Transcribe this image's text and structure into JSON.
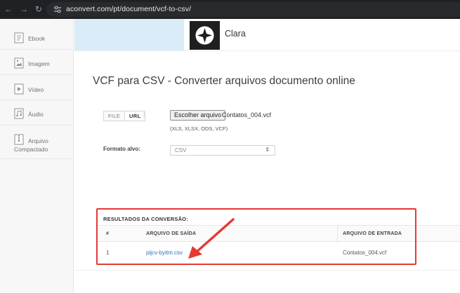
{
  "browser": {
    "url": "aconvert.com/pt/document/vcf-to-csv/"
  },
  "sidebar": {
    "items": [
      {
        "label": "Ebook",
        "icon": "ebook-icon"
      },
      {
        "label": "Imagem",
        "icon": "image-icon"
      },
      {
        "label": "Vídeo",
        "icon": "video-icon"
      },
      {
        "label": "Áudio",
        "icon": "audio-icon"
      },
      {
        "label": "Arquivo Compactado",
        "icon": "archive-icon"
      }
    ]
  },
  "ad": {
    "brand": "Clara"
  },
  "page_title": "VCF para CSV - Converter arquivos documento online",
  "source_tabs": [
    {
      "label": "FILE",
      "active": false
    },
    {
      "label": "URL",
      "active": true
    }
  ],
  "source_colon": ":",
  "file": {
    "button_label": "Escolher arquivo",
    "chosen_name": "Contatos_004.vcf",
    "formats_hint": "(XLS, XLSX, ODS, VCF)"
  },
  "target": {
    "label": "Formato alvo:",
    "value": "CSV"
  },
  "results": {
    "heading": "RESULTADOS DA CONVERSÃO:",
    "columns": [
      "#",
      "ARQUIVO DE SAÍDA",
      "ARQUIVO DE ENTRADA"
    ],
    "rows": [
      {
        "index": "1",
        "output": "pijcv-byitm.csv",
        "input": "Contatos_004.vcf"
      }
    ]
  },
  "colors": {
    "highlight": "#e53935",
    "link": "#2a6fbf",
    "ad_blue": "#d9ecf7"
  }
}
